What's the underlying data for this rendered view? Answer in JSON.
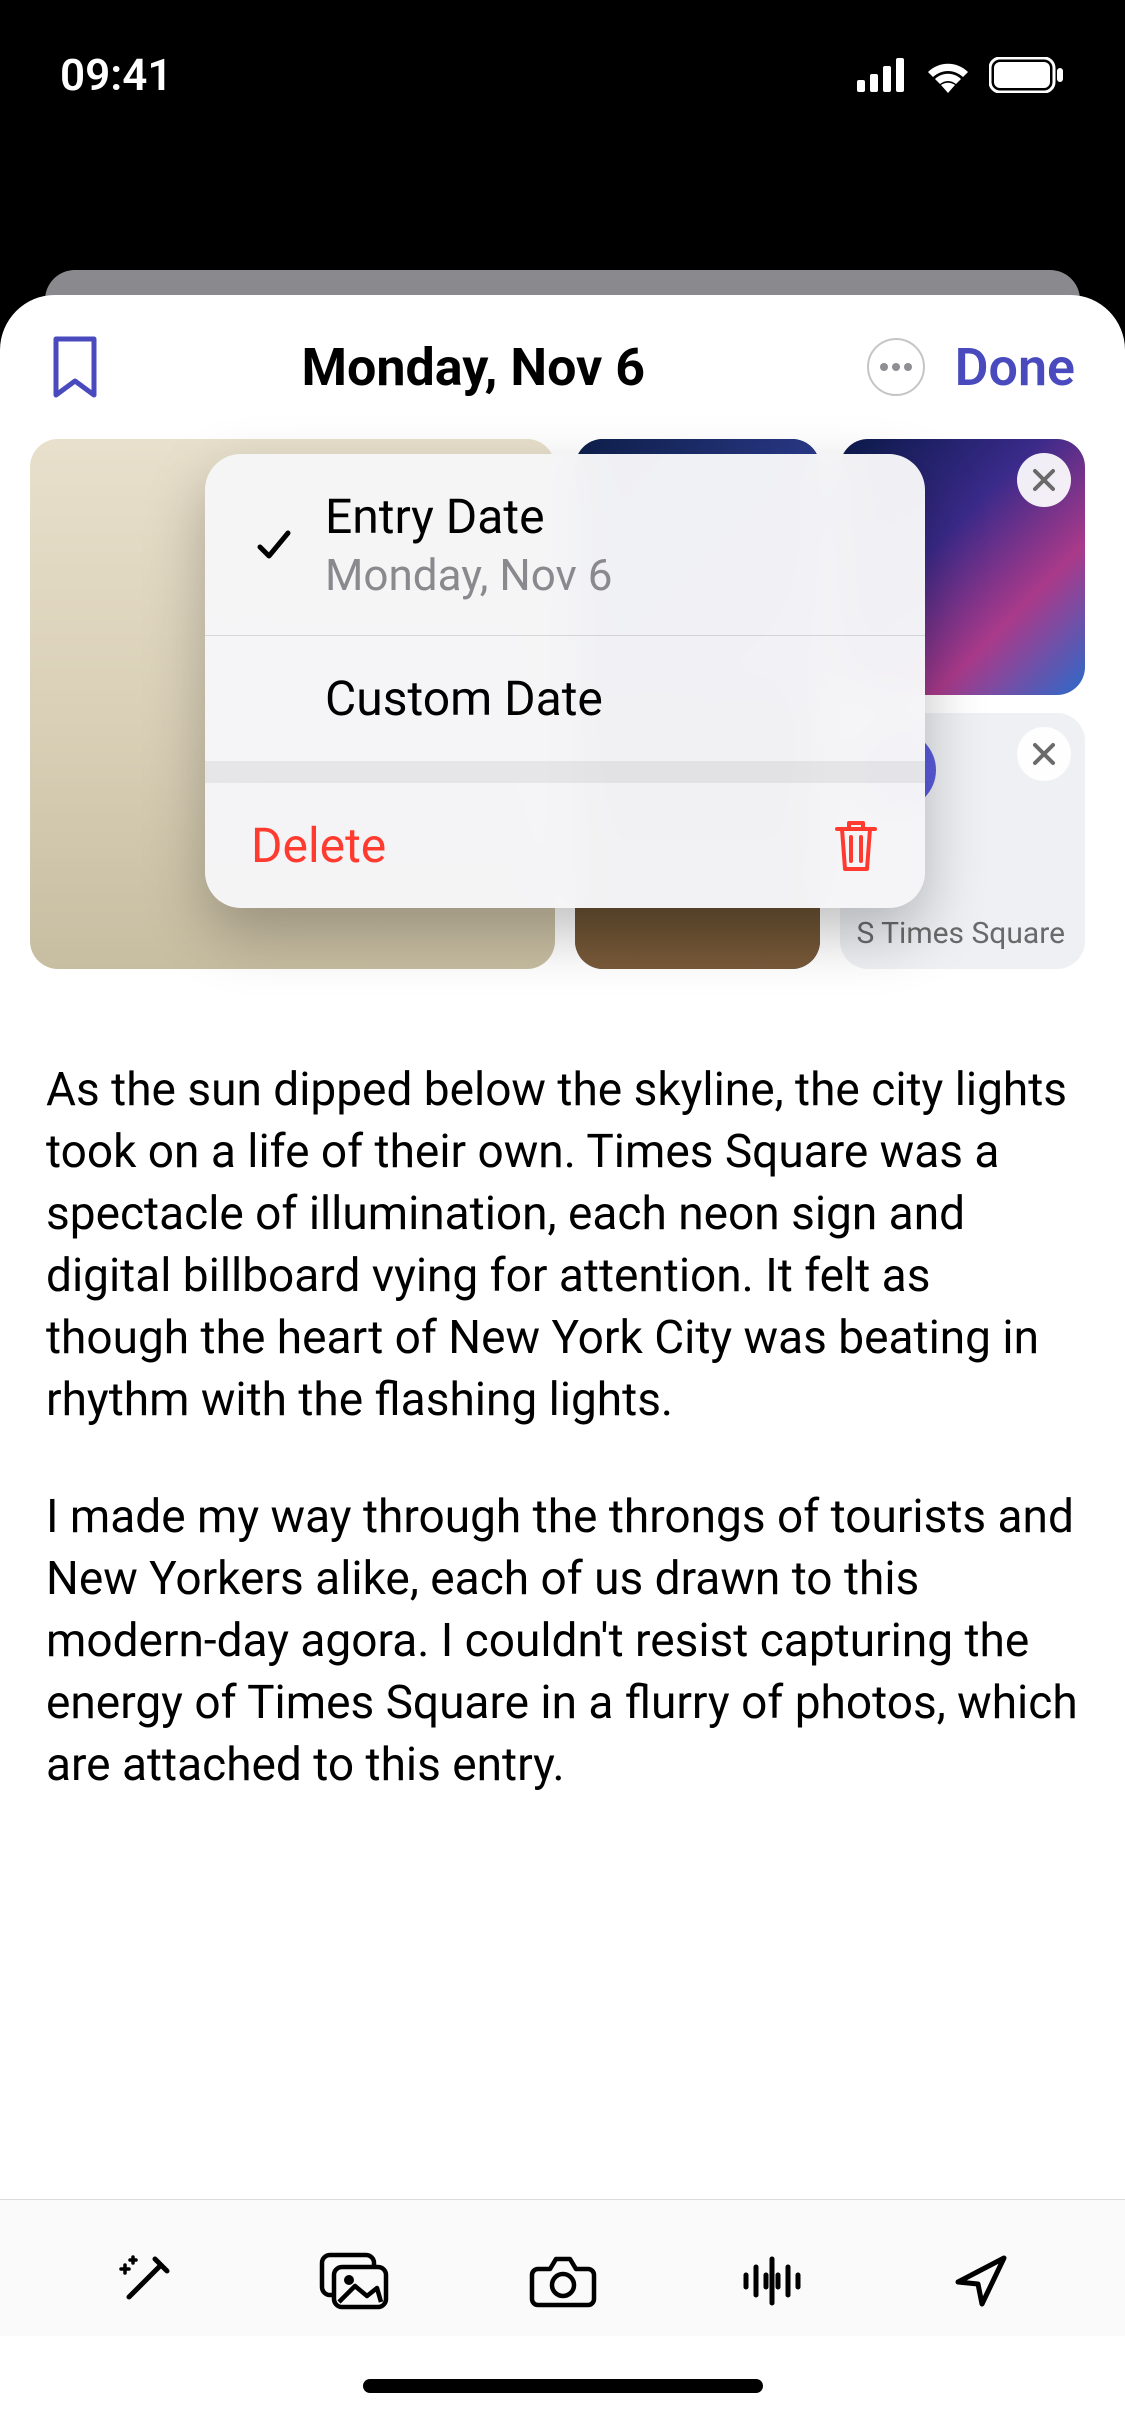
{
  "status": {
    "time": "09:41"
  },
  "header": {
    "title": "Monday, Nov 6",
    "done": "Done"
  },
  "popup": {
    "entry_label": "Entry Date",
    "entry_value": "Monday, Nov 6",
    "custom_label": "Custom Date",
    "delete_label": "Delete"
  },
  "map": {
    "label": "S Times Square"
  },
  "entry": {
    "p1": "As the sun dipped below the skyline, the city lights took on a life of their own. Times Square was a spectacle of illumination, each neon sign and digital billboard vying for attention. It felt as though the heart of New York City was beating in rhythm with the flashing lights.",
    "p2": "I made my way through the throngs of tourists and New Yorkers alike, each of us drawn to this modern-day agora. I couldn't resist capturing the energy of Times Square in a flurry of photos, which are attached to this entry."
  }
}
